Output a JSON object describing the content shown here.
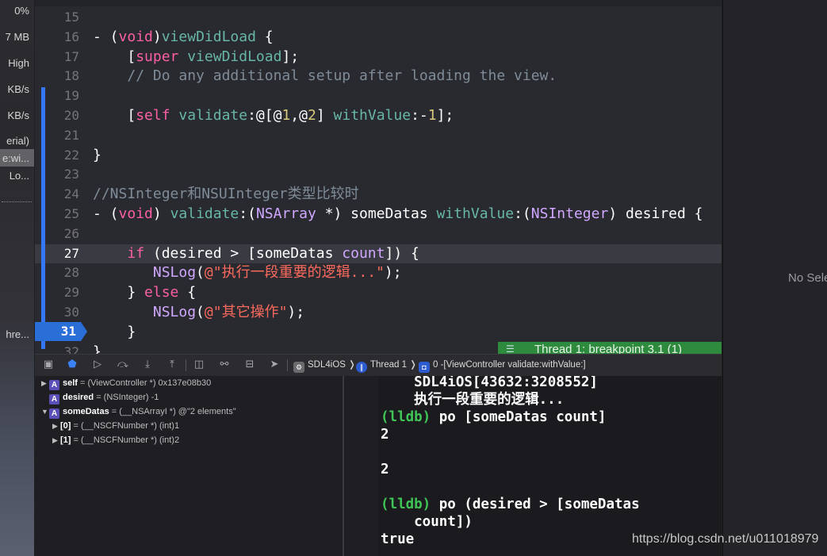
{
  "gauges": [
    {
      "name": "cpu-gauge",
      "text": "0%"
    },
    {
      "name": "memory-gauge",
      "text": "7 MB"
    },
    {
      "name": "energy-gauge",
      "text": "High"
    },
    {
      "name": "disk-gauge",
      "text": "KB/s"
    },
    {
      "name": "network-gauge",
      "text": "KB/s"
    },
    {
      "name": "queue-label",
      "text": "erial)"
    },
    {
      "name": "frame-label-1",
      "text": "e:wi..."
    },
    {
      "name": "frame-label-2",
      "text": "Lo..."
    },
    {
      "name": "thread-label",
      "text": "hre..."
    }
  ],
  "editor": {
    "lines": [
      {
        "n": "15",
        "html": ""
      },
      {
        "n": "16",
        "html": "- (<span class=\"kw\">void</span>)<span class=\"fn\">viewDidLoad</span> {"
      },
      {
        "n": "17",
        "html": "    [<span class=\"kw\">super</span> <span class=\"fn\">viewDidLoad</span>];"
      },
      {
        "n": "18",
        "html": "    <span class=\"cm\">// Do any additional setup after loading the view.</span>"
      },
      {
        "n": "19",
        "html": ""
      },
      {
        "n": "20",
        "html": "    [<span class=\"kw\">self</span> <span class=\"fn\">validate</span>:@[@<span class=\"num\">1</span>,@<span class=\"num\">2</span>] <span class=\"fn\">withValue</span>:-<span class=\"num\">1</span>];"
      },
      {
        "n": "21",
        "html": ""
      },
      {
        "n": "22",
        "html": "}"
      },
      {
        "n": "23",
        "html": ""
      },
      {
        "n": "24",
        "html": "<span class=\"cm\">//NSInteger和NSUInteger类型比较时</span>"
      },
      {
        "n": "25",
        "html": "- (<span class=\"kw\">void</span>) <span class=\"fn\">validate</span>:(<span class=\"ty\">NSArray</span> *) someDatas <span class=\"fn\">withValue</span>:(<span class=\"ty\">NSInteger</span>) desired {"
      },
      {
        "n": "26",
        "html": ""
      },
      {
        "n": "27",
        "html": "    <span class=\"kw\">if</span> (desired &gt; [someDatas <span class=\"ty\">count</span>]) {"
      },
      {
        "n": "28",
        "html": "       <span class=\"ty\">NSLog</span>(<span class=\"str\">@\"执行一段重要的逻辑...\"</span>);"
      },
      {
        "n": "29",
        "html": "    } <span class=\"kw\">else</span> {"
      },
      {
        "n": "30",
        "html": "       <span class=\"ty\">NSLog</span>(<span class=\"str\">@\"其它操作\"</span>);"
      },
      {
        "n": "31",
        "html": "    }"
      },
      {
        "n": "32",
        "html": "}"
      }
    ],
    "current_line": "27",
    "breakpoint_line": "31",
    "thread_banner": "Thread 1: breakpoint 3.1 (1)"
  },
  "debugbar": {
    "target": "SDL4iOS",
    "thread": "Thread 1",
    "frame": "0 -[ViewController validate:withValue:]"
  },
  "variables": [
    {
      "indent": 0,
      "tri": "▶",
      "badge": "A",
      "name": "self",
      "value": "= (ViewController *) 0x137e08b30"
    },
    {
      "indent": 0,
      "tri": "",
      "badge": "A",
      "name": "desired",
      "value": "= (NSInteger) -1"
    },
    {
      "indent": 0,
      "tri": "▼",
      "badge": "A",
      "name": "someDatas",
      "value": "= (__NSArrayI *) @\"2 elements\""
    },
    {
      "indent": 1,
      "tri": "▶",
      "badge": "",
      "name": "[0]",
      "value": "= (__NSCFNumber *) (int)1"
    },
    {
      "indent": 1,
      "tri": "▶",
      "badge": "",
      "name": "[1]",
      "value": "= (__NSCFNumber *) (int)2"
    }
  ],
  "console": [
    {
      "prompt": "",
      "text": "    SDL4iOS[43632:3208552]"
    },
    {
      "prompt": "",
      "text": "    执行一段重要的逻辑..."
    },
    {
      "prompt": "(lldb)",
      "text": " po [someDatas count]"
    },
    {
      "prompt": "",
      "text": "2"
    },
    {
      "prompt": "",
      "text": ""
    },
    {
      "prompt": "",
      "text": "2"
    },
    {
      "prompt": "",
      "text": ""
    },
    {
      "prompt": "(lldb)",
      "text": " po (desired > [someDatas"
    },
    {
      "prompt": "",
      "text": "    count])"
    },
    {
      "prompt": "",
      "text": "true"
    }
  ],
  "inspector": {
    "empty_label": "No Selection"
  },
  "watermark": "https://blog.csdn.net/u011018979"
}
